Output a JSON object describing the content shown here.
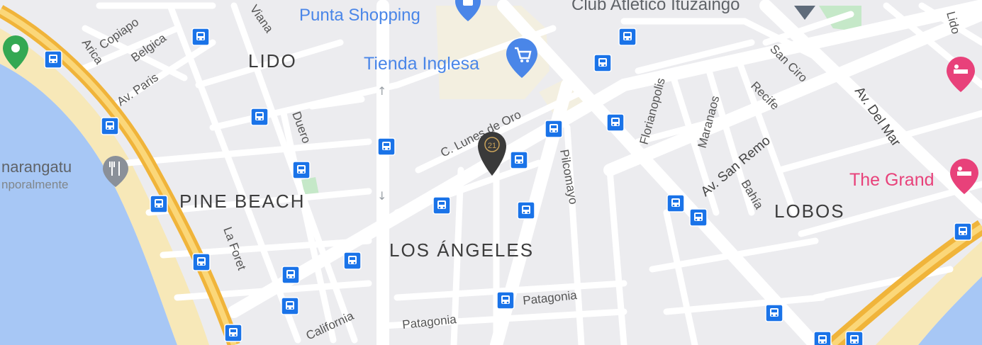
{
  "map": {
    "neighborhoods": {
      "lido": "LIDO",
      "pine_beach": "PINE BEACH",
      "los_angeles": "LOS ÁNGELES",
      "lobos": "LOBOS"
    },
    "streets": {
      "copiapo": "Copiapo",
      "arica": "Arica",
      "belgica": "Belgica",
      "av_paris": "Av. Paris",
      "viana": "Viana",
      "duero": "Duero",
      "la_foret": "La Foret",
      "california": "California",
      "patagonia_1": "Patagonia",
      "patagonia_2": "Patagonia",
      "lunes_de_oro": "C. Lunes de Oro",
      "pilcomayo": "Pilcomayo",
      "florianopolis": "Florianopolis",
      "maranaos": "Maranaos",
      "recife": "Recife",
      "san_ciro": "San Ciro",
      "av_san_remo": "Av. San Remo",
      "bahia": "Bahía",
      "av_del_mar": "Av. Del Mar",
      "lido_street": "Lido"
    },
    "places": {
      "punta_shopping": "Punta Shopping",
      "tienda_inglesa": "Tienda Inglesa",
      "club_atletico": "Club Atletico Ituzaingo",
      "the_grand": "The Grand",
      "marangatu_name": "narangatu",
      "marangatu_status": "nporalmente"
    },
    "marker_label": "21",
    "colors": {
      "water": "#a7c7f5",
      "sand": "#f7e8b8",
      "land": "#ededf0",
      "road": "#ffffff",
      "highway": "#f5c24a",
      "transit": "#1a73e8",
      "place_blue": "#4a86e8",
      "hotel_pink": "#e8417a",
      "park": "#c5e8c8",
      "green_pin": "#34a853",
      "marker": "#3a3a3a"
    }
  }
}
